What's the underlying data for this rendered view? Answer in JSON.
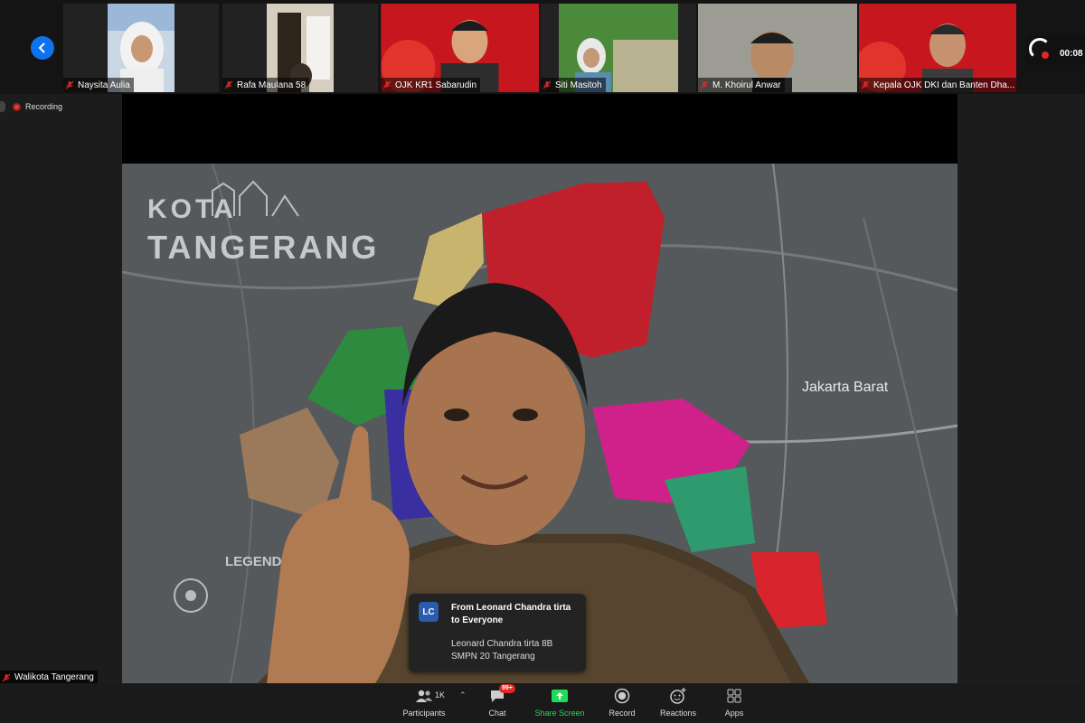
{
  "participants_strip": [
    {
      "name": "Naysita Aulia"
    },
    {
      "name": "Rafa Maulana 58"
    },
    {
      "name": "OJK KR1 Sabarudin"
    },
    {
      "name": "Siti Masitoh"
    },
    {
      "name": "M. Khoirul Anwar"
    },
    {
      "name": "Kepala OJK DKI dan Banten Dha..."
    }
  ],
  "recording": {
    "label": "Recording",
    "timer": "00:08"
  },
  "active_speaker": {
    "name": "Walikota Tangerang"
  },
  "background": {
    "title_line1": "KOTA",
    "title_line2": "TANGERANG",
    "map_label": "Jakarta Barat",
    "legend_label": "LEGEND"
  },
  "chat_toast": {
    "initials": "LC",
    "from_line1": "From Leonard Chandra tirta",
    "from_line2": "to Everyone",
    "message_line1": "Leonard Chandra tirta 8B",
    "message_line2": "SMPN 20 Tangerang"
  },
  "toolbar": {
    "participants_label": "Participants",
    "participants_count": "1K",
    "chat_label": "Chat",
    "chat_badge": "99+",
    "share_label": "Share Screen",
    "record_label": "Record",
    "reactions_label": "Reactions",
    "apps_label": "Apps"
  },
  "colors": {
    "accent": "#0e72ed",
    "share_green": "#23d959",
    "recording_red": "#e02828"
  }
}
